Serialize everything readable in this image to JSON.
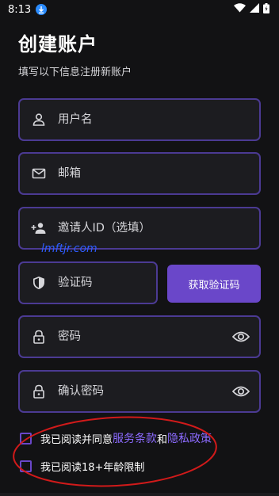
{
  "status_bar": {
    "time": "8:13",
    "icons": [
      "download-icon",
      "wifi-icon",
      "signal-icon",
      "battery-icon"
    ]
  },
  "header": {
    "title": "创建账户",
    "subtitle": "填写以下信息注册新账户"
  },
  "form": {
    "username": {
      "placeholder": "用户名",
      "icon": "person-icon"
    },
    "email": {
      "placeholder": "邮箱",
      "icon": "mail-icon"
    },
    "invite": {
      "placeholder": "邀请人ID（选填）",
      "icon": "person-add-icon"
    },
    "code": {
      "placeholder": "验证码",
      "icon": "shield-icon"
    },
    "get_code_label": "获取验证码",
    "password": {
      "placeholder": "密码",
      "icon": "lock-icon",
      "trailing_icon": "eye-icon"
    },
    "confirm_password": {
      "placeholder": "确认密码",
      "icon": "lock-icon",
      "trailing_icon": "eye-icon"
    }
  },
  "watermark": "lmftjr.com",
  "agreements": {
    "terms_prefix": "我已阅读并同意",
    "terms_link": "服务条款",
    "terms_and": "和",
    "privacy_link": "隐私政策",
    "age_label": "我已阅读18+年龄限制"
  },
  "colors": {
    "background": "#121214",
    "field_border": "#4b3a93",
    "accent": "#6a47c9",
    "link": "#8c6bff",
    "annotation": "#d11a1a"
  }
}
